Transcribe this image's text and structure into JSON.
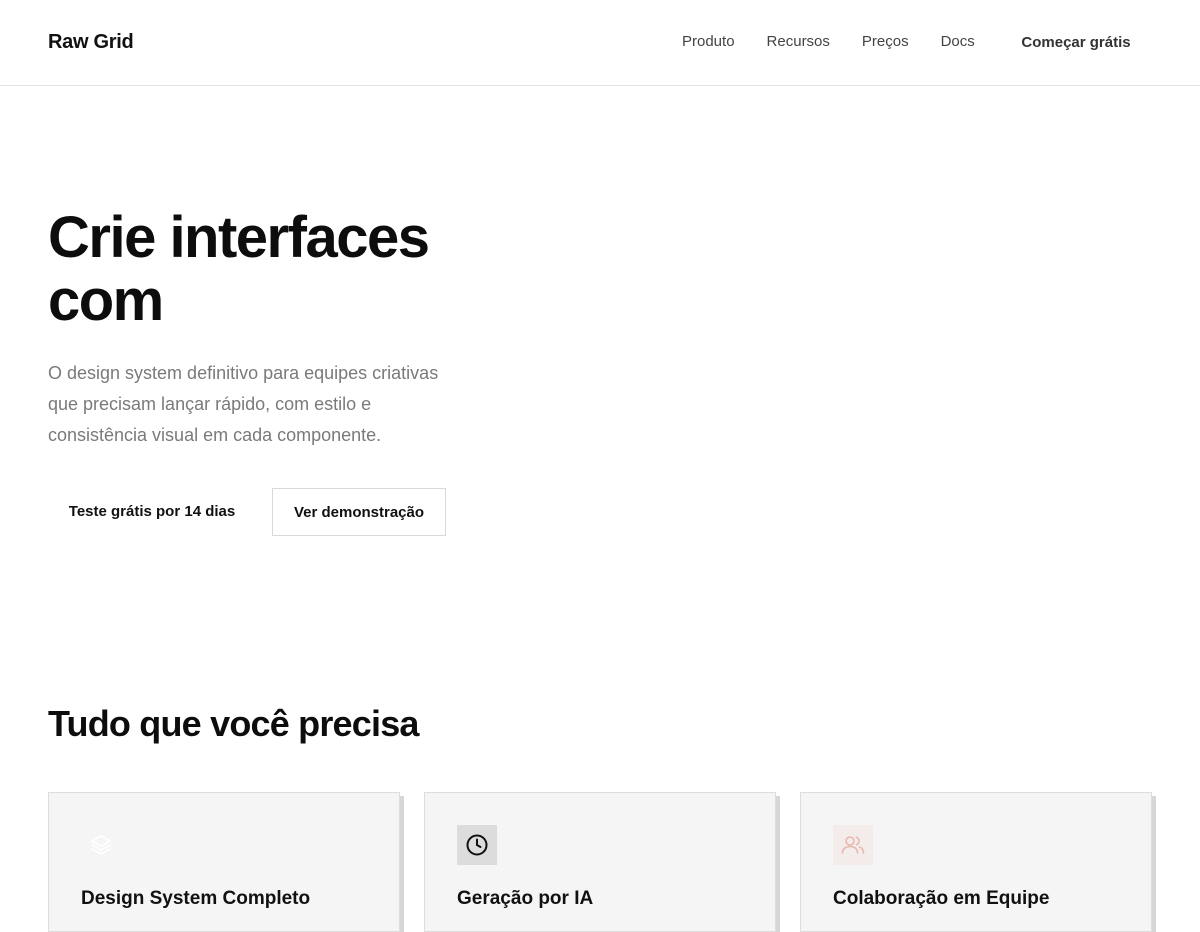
{
  "header": {
    "brand": "Raw Grid",
    "nav": [
      "Produto",
      "Recursos",
      "Preços",
      "Docs"
    ],
    "cta": "Começar grátis"
  },
  "hero": {
    "title": "Crie interfaces com",
    "subtitle": "O design system definitivo para equipes criativas que precisam lançar rápido, com estilo e consistência visual em cada componente.",
    "primary_button": "Teste grátis por 14 dias",
    "secondary_button": "Ver demonstração"
  },
  "features": {
    "title": "Tudo que você precisa",
    "cards": [
      {
        "title": "Design System Completo",
        "icon": "layers-icon"
      },
      {
        "title": "Geração por IA",
        "icon": "clock-icon"
      },
      {
        "title": "Colaboração em Equipe",
        "icon": "users-icon"
      }
    ]
  },
  "colors": {
    "text": "#111111",
    "muted": "#7a7a7a",
    "card_bg": "#f5f5f5",
    "users_icon": "#e8b8ae"
  }
}
